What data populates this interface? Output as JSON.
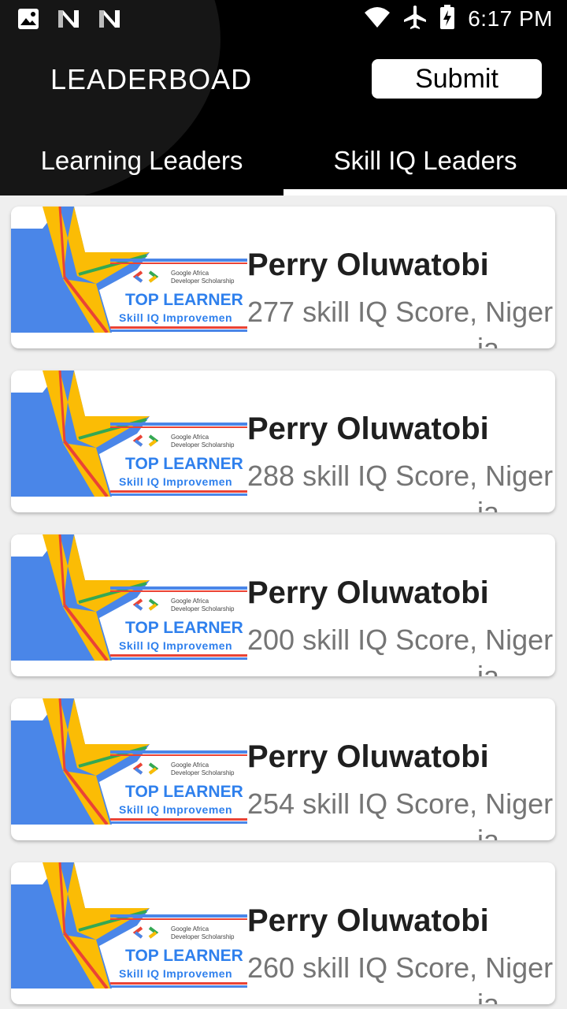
{
  "status_bar": {
    "time": "6:17 PM",
    "icons_left": [
      "image-icon",
      "n-notification-icon",
      "n-notification-icon"
    ],
    "icons_right": [
      "wifi-icon",
      "airplane-icon",
      "battery-charging-icon"
    ]
  },
  "app_bar": {
    "title": "LEADERBOAD",
    "submit_label": "Submit",
    "background": "#000000"
  },
  "tabs": [
    {
      "label": "Learning Leaders",
      "selected": false
    },
    {
      "label": "Skill IQ Leaders",
      "selected": true
    }
  ],
  "badge": {
    "line1": "Google Africa",
    "line2": "Developer Scholarship",
    "headline": "TOP LEARNER",
    "subline": "Skill IQ Improvemen"
  },
  "leaders": [
    {
      "name": "Perry Oluwatobi",
      "score_text": "277 skill IQ Score, Niger",
      "overflow": "ia"
    },
    {
      "name": "Perry Oluwatobi",
      "score_text": "288 skill IQ Score, Niger",
      "overflow": "ia"
    },
    {
      "name": "Perry Oluwatobi",
      "score_text": "200 skill IQ Score, Niger",
      "overflow": "ia"
    },
    {
      "name": "Perry Oluwatobi",
      "score_text": "254 skill IQ Score, Niger",
      "overflow": "ia"
    },
    {
      "name": "Perry Oluwatobi",
      "score_text": "260 skill IQ Score, Niger",
      "overflow": "ia"
    }
  ],
  "colors": {
    "star_blue": "#4a86e8",
    "star_yellow": "#fbbc05",
    "star_red": "#ea4335",
    "star_green": "#34a853",
    "badge_blue": "#2f80ed"
  }
}
